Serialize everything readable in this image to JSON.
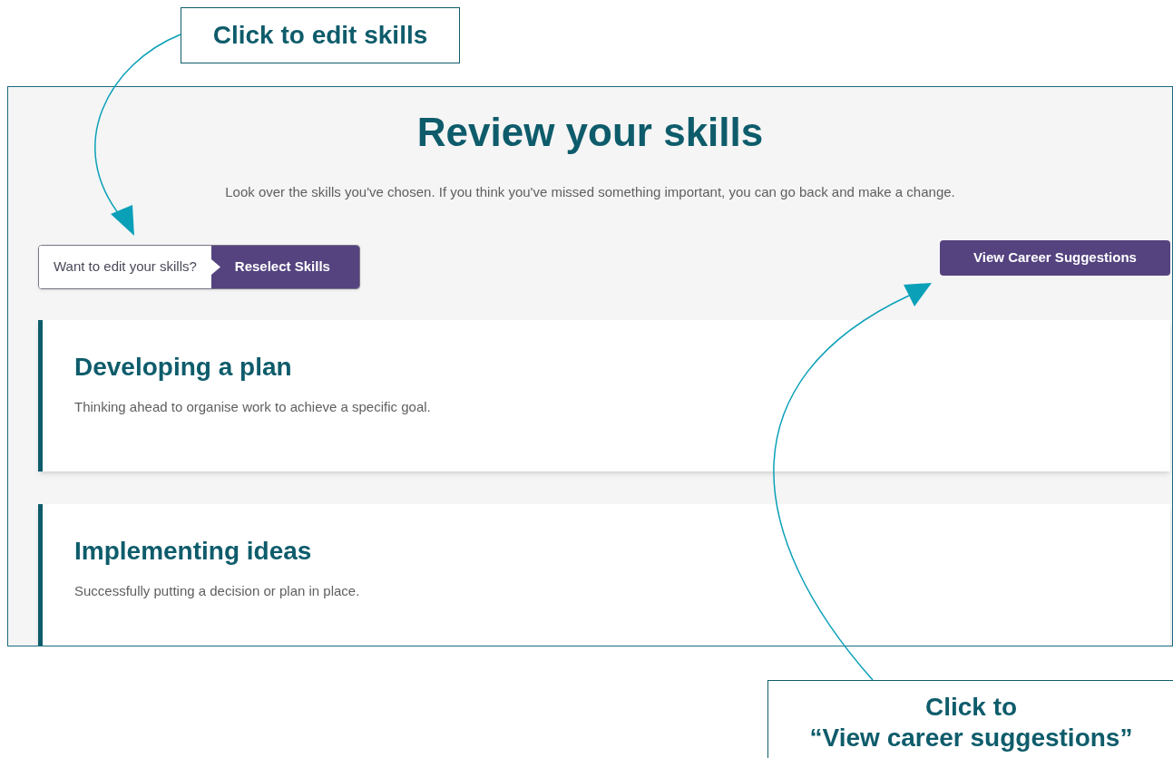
{
  "callouts": [
    {
      "lines": [
        "Click to edit skills"
      ]
    },
    {
      "lines": [
        "Click to",
        "“View career suggestions”"
      ]
    }
  ],
  "page": {
    "title": "Review your skills",
    "intro": "Look over the skills you've chosen. If you think you've missed something important, you can go back and make a change.",
    "edit_prompt": {
      "label": "Want to edit your skills?",
      "button": "Reselect Skills"
    },
    "primary_button": "View Career Suggestions",
    "skills": [
      {
        "title": "Developing a plan",
        "description": "Thinking ahead to organise work to achieve a specific goal."
      },
      {
        "title": "Implementing ideas",
        "description": "Successfully putting a decision or plan in place."
      }
    ]
  }
}
